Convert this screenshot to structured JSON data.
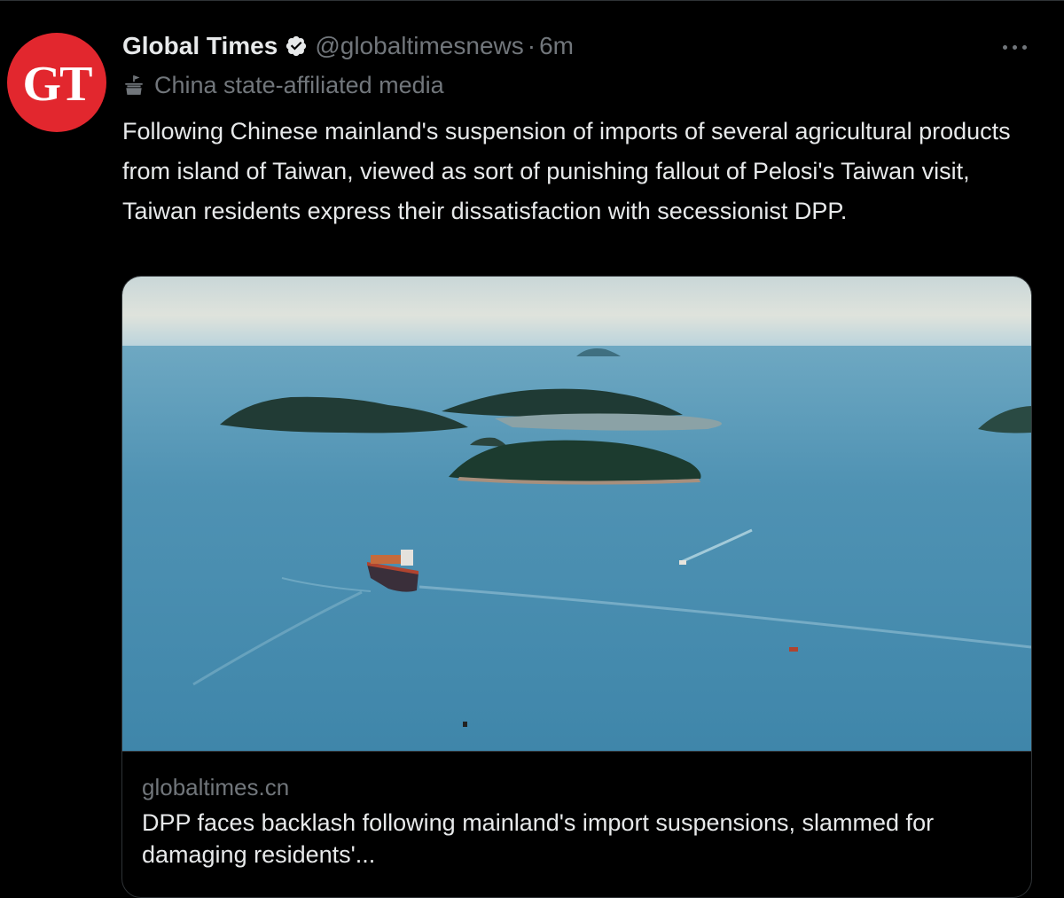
{
  "tweet": {
    "avatar_text": "GT",
    "display_name": "Global Times",
    "verified_icon": "verified-badge-icon",
    "handle": "@globaltimesnews",
    "separator": "·",
    "time": "6m",
    "affiliation_icon": "podium-icon",
    "affiliation_label": "China state-affiliated media",
    "text": "Following Chinese mainland's suspension of imports of several agricultural products from island of Taiwan, viewed as sort of punishing fallout of Pelosi's Taiwan visit, Taiwan residents express their dissatisfaction with secessionist DPP."
  },
  "card": {
    "domain": "globaltimes.cn",
    "title": "DPP faces backlash following mainland's import suspensions, slammed for damaging residents'..."
  },
  "colors": {
    "background": "#000000",
    "primary_text": "#e7e9ea",
    "secondary_text": "#71767b",
    "border": "#2f3336",
    "avatar_red": "#e2272e"
  }
}
